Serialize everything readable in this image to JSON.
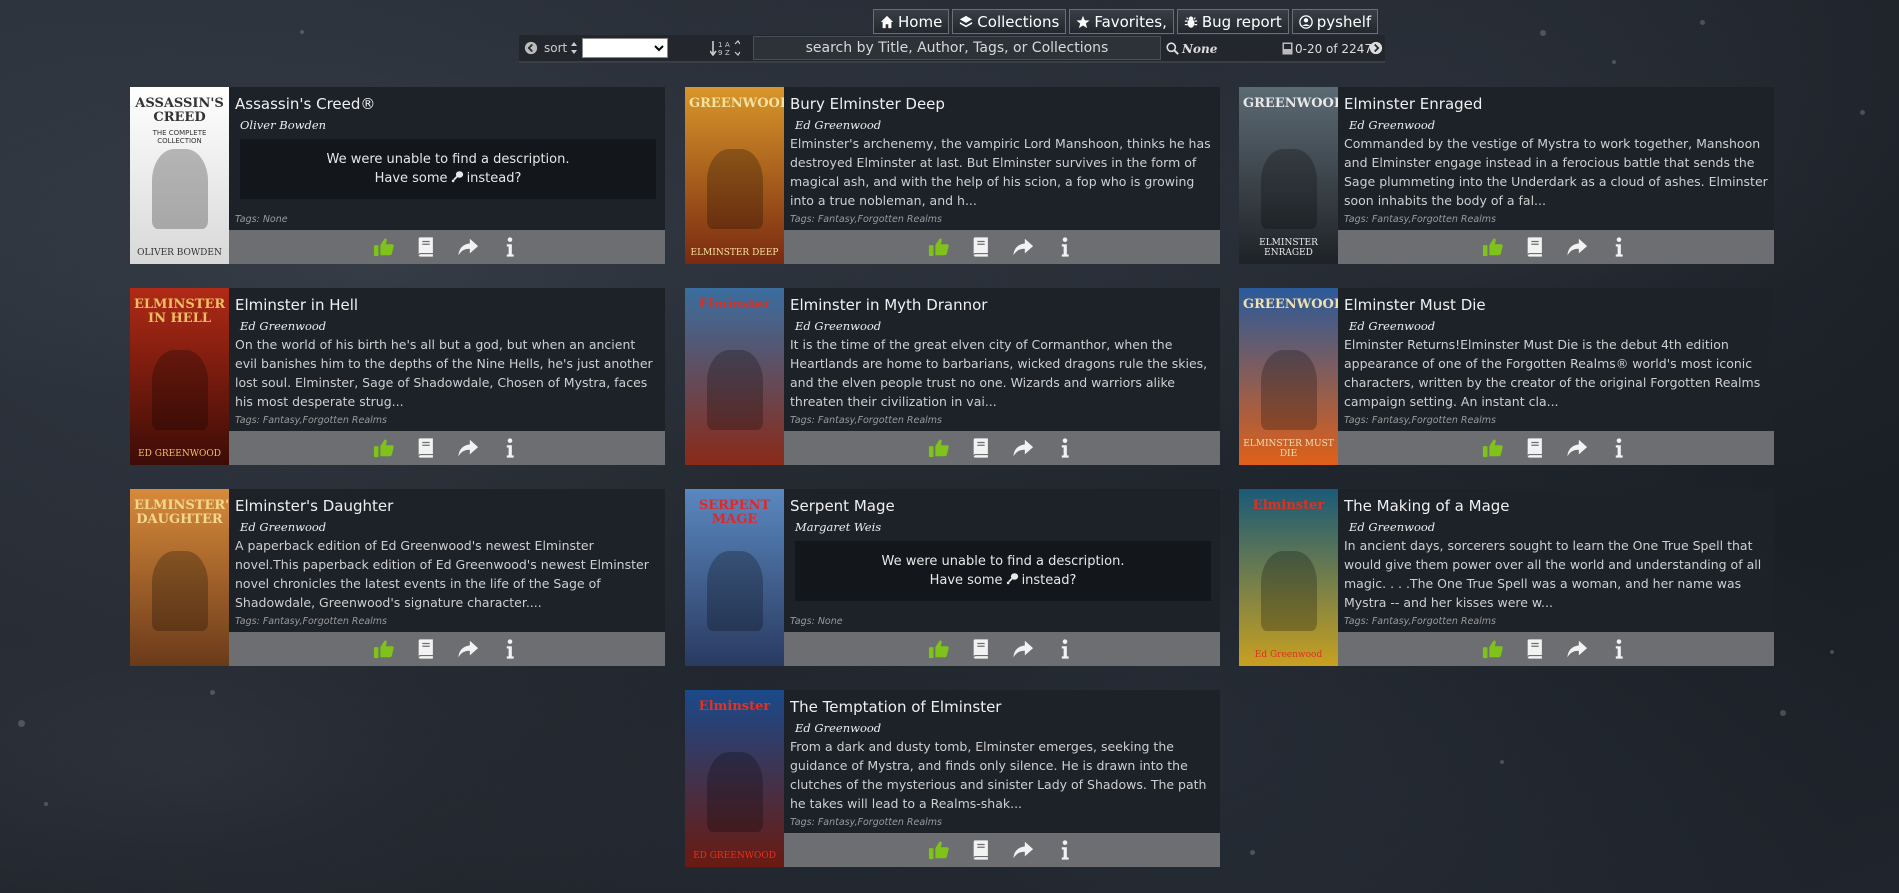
{
  "nav": {
    "home": "Home",
    "collections": "Collections",
    "favorites": "Favorites,",
    "bug_report": "Bug report",
    "user": "pyshelf"
  },
  "toolbar": {
    "sort_label": "sort",
    "sort_value": "",
    "search_placeholder": "search by Title, Author, Tags, or Collections",
    "search_value": "",
    "filter_text": "None",
    "page_range": "0-20 of 2247"
  },
  "no_description": {
    "line1": "We were unable to find a description.",
    "line2a": "Have some",
    "line2b": "instead?"
  },
  "books": [
    {
      "title": "Assassin's Creed®",
      "author": "Oliver Bowden",
      "description": "",
      "tags": "Tags: None",
      "cover": {
        "top": "#ffffff",
        "bottom": "#d8d8d8",
        "text": "ASSASSIN'S CREED",
        "sub": "THE COMPLETE COLLECTION",
        "footer": "OLIVER BOWDEN",
        "ink": "#333"
      }
    },
    {
      "title": "Bury Elminster Deep",
      "author": "Ed Greenwood",
      "description": "Elminster's archenemy, the vampiric Lord Manshoon, thinks he has destroyed Elminster at last. But Elminster survives in the form of magical ash, and with the help of his scion, a fop who is growing into a true nobleman, and h...",
      "tags": "Tags: Fantasy,Forgotten Realms",
      "cover": {
        "top": "#d8962a",
        "bottom": "#7a2a10",
        "text": "GREENWOOD",
        "sub": "",
        "footer": "ELMINSTER DEEP",
        "ink": "#f6e2a0"
      }
    },
    {
      "title": "Elminster Enraged",
      "author": "Ed Greenwood",
      "description": "Commanded by the vestige of Mystra to work together, Manshoon and Elminster engage instead in a ferocious battle that sends the Sage plummeting into the Underdark as a cloud of ashes. Elminster soon inhabits the body of a fal...",
      "tags": "Tags: Fantasy,Forgotten Realms",
      "cover": {
        "top": "#5c6a74",
        "bottom": "#1e2226",
        "text": "GREENWOOD",
        "sub": "",
        "footer": "ELMINSTER ENRAGED",
        "ink": "#e8e8e8"
      }
    },
    {
      "title": "Elminster in Hell",
      "author": "Ed Greenwood",
      "description": "On the world of his birth he's all but a god, but when an ancient evil banishes him to the depths of the Nine Hells, he's just another lost soul. Elminster, Sage of Shadowdale, Chosen of Mystra, faces his most desperate strug...",
      "tags": "Tags: Fantasy,Forgotten Realms",
      "cover": {
        "top": "#b02a16",
        "bottom": "#3c0c06",
        "text": "ELMINSTER IN HELL",
        "sub": "",
        "footer": "ED GREENWOOD",
        "ink": "#f2c060"
      }
    },
    {
      "title": "Elminster in Myth Drannor",
      "author": "Ed Greenwood",
      "description": "It is the time of the great elven city of Cormanthor, when the Heartlands are home to barbarians, wicked dragons rule the skies, and the elven people trust no one. Wizards and warriors alike threaten their civilization in vai...",
      "tags": "Tags: Fantasy,Forgotten Realms",
      "cover": {
        "top": "#3a6ea0",
        "bottom": "#8a2a18",
        "text": "Elminster",
        "sub": "",
        "footer": "",
        "ink": "#d83020"
      }
    },
    {
      "title": "Elminster Must Die",
      "author": "Ed Greenwood",
      "description": "Elminster Returns!Elminster Must Die is the debut 4th edition appearance of one of the Forgotten Realms® world's most iconic characters, written by the creator of the original Forgotten Realms campaign setting. An instant cla...",
      "tags": "Tags: Fantasy,Forgotten Realms",
      "cover": {
        "top": "#2a5a9a",
        "bottom": "#e06018",
        "text": "GREENWOOD",
        "sub": "",
        "footer": "ELMINSTER MUST DIE",
        "ink": "#f0e0b0"
      }
    },
    {
      "title": "Elminster's Daughter",
      "author": "Ed Greenwood",
      "description": "A paperback edition of Ed Greenwood's newest Elminster novel.This paperback edition of Ed Greenwood's newest Elminster novel chronicles the latest events in the life of the Sage of Shadowdale, Greenwood's signature character....",
      "tags": "Tags: Fantasy,Forgotten Realms",
      "cover": {
        "top": "#d88a3a",
        "bottom": "#6a3a1a",
        "text": "ELMINSTER'S DAUGHTER",
        "sub": "",
        "footer": "",
        "ink": "#f4d890"
      }
    },
    {
      "title": "Serpent Mage",
      "author": "Margaret Weis",
      "description": "",
      "tags": "Tags: None",
      "cover": {
        "top": "#5a88c0",
        "bottom": "#2a3a60",
        "text": "SERPENT MAGE",
        "sub": "",
        "footer": "",
        "ink": "#e02828"
      }
    },
    {
      "title": "The Making of a Mage",
      "author": "Ed Greenwood",
      "description": "In ancient days, sorcerers sought to learn the One True Spell that would give them power over all the world and understanding of all magic. . . .The One True Spell was a woman, and her name was Mystra -- and her kisses were w...",
      "tags": "Tags: Fantasy,Forgotten Realms",
      "cover": {
        "top": "#1a5a78",
        "bottom": "#c8a020",
        "text": "Elminster",
        "sub": "",
        "footer": "Ed Greenwood",
        "ink": "#e03020"
      }
    },
    {
      "title": "The Temptation of Elminster",
      "author": "Ed Greenwood",
      "description": "From a dark and dusty tomb, Elminster emerges, seeking the guidance of Mystra, and finds only silence. He is drawn into the clutches of the mysterious and sinister Lady of Shadows. The path he takes will lead to a Realms-shak...",
      "tags": "Tags: Fantasy,Forgotten Realms",
      "cover": {
        "top": "#1a4a8a",
        "bottom": "#6a1a10",
        "text": "Elminster",
        "sub": "",
        "footer": "ED GREENWOOD",
        "ink": "#e83020"
      }
    }
  ],
  "colors": {
    "like": "#7ec21a",
    "icon": "#f2f2f2",
    "action_bar": "#6c6e72",
    "card_bg": "#1d2128"
  },
  "action_icons": [
    "thumbs-up-icon",
    "read-book-icon",
    "share-icon",
    "info-icon"
  ]
}
